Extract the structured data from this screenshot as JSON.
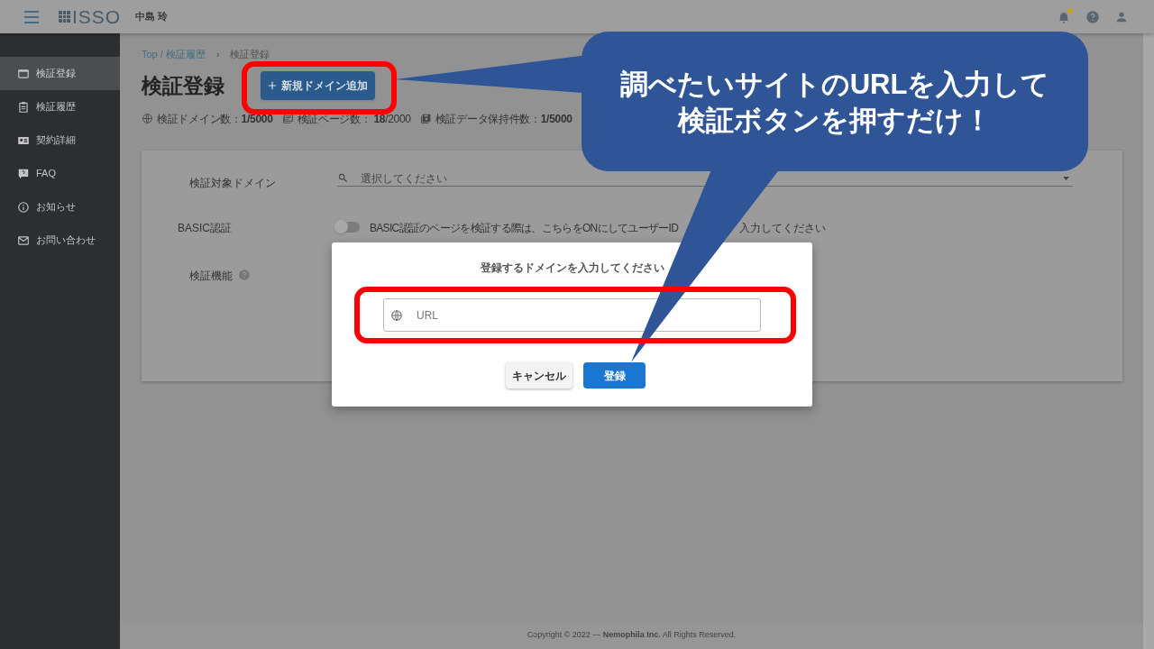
{
  "header": {
    "logo": "ISSO",
    "user": "中島 玲",
    "has_notification": true
  },
  "sidebar": {
    "items": [
      {
        "label": "検証登録",
        "selected": true
      },
      {
        "label": "検証履歴",
        "selected": false
      },
      {
        "label": "契約詳細",
        "selected": false
      },
      {
        "label": "FAQ",
        "selected": false
      },
      {
        "label": "お知らせ",
        "selected": false
      },
      {
        "label": "お問い合わせ",
        "selected": false
      }
    ]
  },
  "breadcrumb": {
    "items": [
      {
        "label": "Top / 検証履歴",
        "link": true
      },
      {
        "label": "検証登録",
        "link": false
      }
    ],
    "separator": "›"
  },
  "page_title": "検証登録",
  "add_button": "新規ドメイン追加",
  "stats": [
    "検証ドメイン数：**1/5000**",
    "検証ページ数： **18**/2000",
    "検証データ保持件数：**1/5000**"
  ],
  "form": {
    "domain_label": "検証対象ドメイン",
    "domain_placeholder": "選択してください",
    "basic_label": "BASIC認証",
    "basic_on": false,
    "basic_hint_parts": [
      "BASIC認証のページを検証する際は、こちらをONにしてユーザーID",
      "入力してください"
    ],
    "feature_label": "検証機能"
  },
  "dialog": {
    "title": "登録するドメインを入力してください",
    "url_placeholder": "URL",
    "buttons": [
      {
        "label": "キャンセル",
        "kind": "secondary"
      },
      {
        "label": "登録",
        "kind": "primary"
      }
    ]
  },
  "footer": "Copyright © 2022 — **Nemophila Inc.** All Rights Reserved.",
  "callout": [
    "調べたいサイトのURLを入力して",
    "検証ボタンを押すだけ！"
  ]
}
